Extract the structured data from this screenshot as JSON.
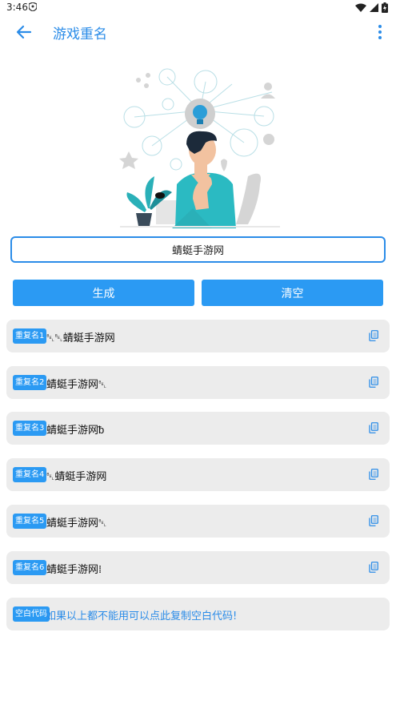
{
  "status": {
    "time": "3:46"
  },
  "appbar": {
    "title": "游戏重名"
  },
  "input": {
    "value": "蜻蜓手游网"
  },
  "buttons": {
    "generate": "生成",
    "clear": "清空"
  },
  "results": [
    {
      "badge": "重复名1",
      "text": "␇␇蜻蜓手游网"
    },
    {
      "badge": "重复名2",
      "text": "蜻蜓手游网␇"
    },
    {
      "badge": "重复名3",
      "text": "蜻蜓手游网ᵬ"
    },
    {
      "badge": "重复名4",
      "text": "␇蜻蜓手游网"
    },
    {
      "badge": "重复名5",
      "text": "蜻蜓手游网␇"
    },
    {
      "badge": "重复名6",
      "text": "蜻蜓手游网⁞"
    }
  ],
  "blank": {
    "badge": "空白代码",
    "text": "如果以上都不能用可以点此复制空白代码!"
  },
  "colors": {
    "accent": "#2b8ce8",
    "button": "#2b9af3",
    "row_bg": "#ececec"
  }
}
